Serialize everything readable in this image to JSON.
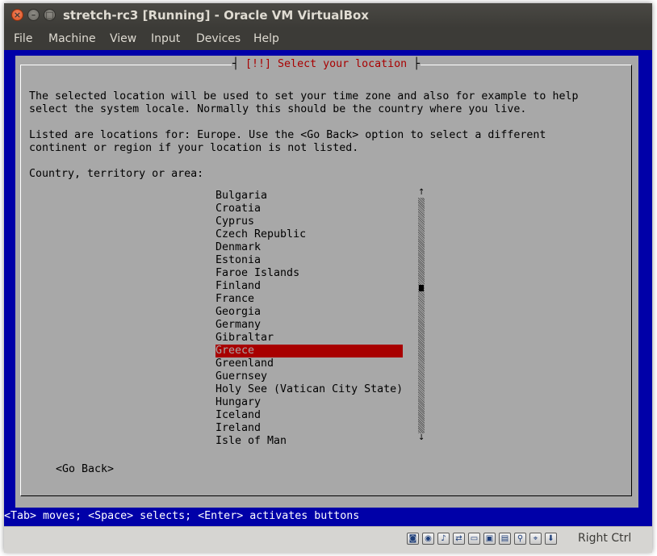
{
  "window": {
    "title": "stretch-rc3 [Running] - Oracle VM VirtualBox",
    "controls": {
      "close": "×",
      "minimize": "–",
      "maximize": "□"
    }
  },
  "menu": [
    "File",
    "Machine",
    "View",
    "Input",
    "Devices",
    "Help"
  ],
  "dialog": {
    "title_left": "┤",
    "title": " [!!] Select your location ",
    "title_right": "├",
    "paragraph1": [
      "The selected location will be used to set your time zone and also for example to help",
      "select the system locale. Normally this should be the country where you live."
    ],
    "paragraph2": [
      "Listed are locations for: Europe. Use the <Go Back> option to select a different",
      "continent or region if your location is not listed."
    ],
    "prompt": "Country, territory or area:",
    "countries": [
      "Bulgaria",
      "Croatia",
      "Cyprus",
      "Czech Republic",
      "Denmark",
      "Estonia",
      "Faroe Islands",
      "Finland",
      "France",
      "Georgia",
      "Germany",
      "Gibraltar",
      "Greece",
      "Greenland",
      "Guernsey",
      "Holy See (Vatican City State)",
      "Hungary",
      "Iceland",
      "Ireland",
      "Isle of Man"
    ],
    "selected_country": "Greece",
    "scroll_up": "↑",
    "scroll_down": "↓",
    "go_back": "<Go Back>"
  },
  "status_line": "<Tab> moves; <Space> selects; <Enter> activates buttons",
  "statusbar": {
    "icons": [
      "hard-disk-icon",
      "optical-drive-icon",
      "audio-icon",
      "network-icon",
      "shared-folder-icon",
      "display-icon",
      "video-capture-icon",
      "usb-icon",
      "mouse-integration-icon",
      "keyboard-icon"
    ],
    "host_key": "Right Ctrl"
  },
  "colors": {
    "background_blue": "#0000a8",
    "dialog_gray": "#a8a8a8",
    "highlight_red": "#a80000",
    "title_red": "#a80000"
  }
}
